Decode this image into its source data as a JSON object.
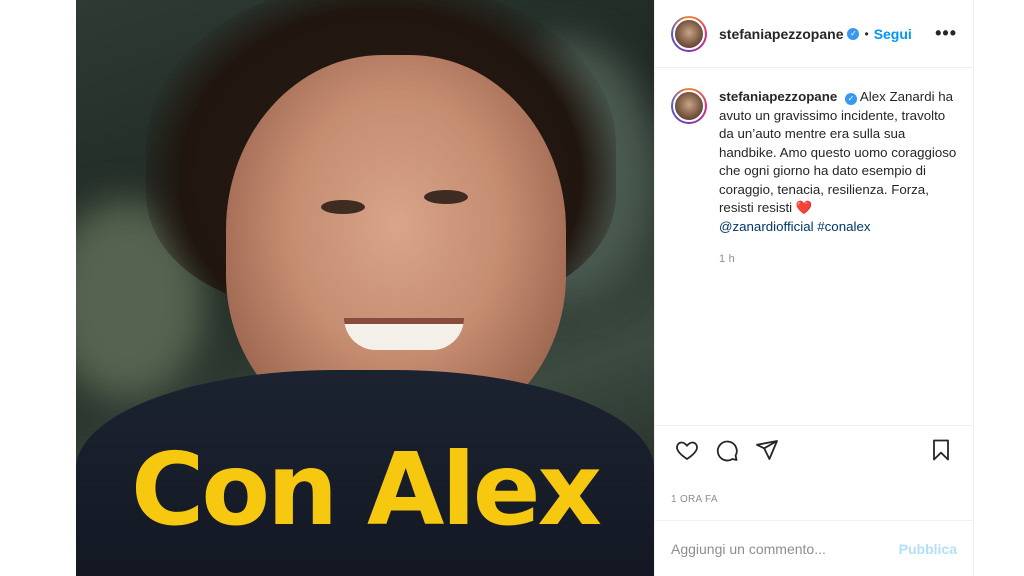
{
  "post": {
    "image_caption": "Con Alex",
    "caption_color": "#f6c910"
  },
  "header": {
    "username": "stefaniapezzopane",
    "verified_mark": "✓",
    "separator": "•",
    "follow_label": "Segui",
    "more_label": "•••"
  },
  "comment": {
    "username": "stefaniapezzopane",
    "text": "Alex Zanardi ha avuto un gravissimo incidente, travolto da un’auto mentre era sulla sua handbike. Amo questo uomo coraggioso che ogni giorno ha dato esempio di coraggio, tenacia, resilienza. Forza, resisti resisti",
    "emoji": "❤️",
    "mention": "@zanardiofficial",
    "hashtag": "#conalex",
    "time": "1 h"
  },
  "actions": {
    "icons": [
      "heart-icon",
      "comment-icon",
      "share-icon",
      "bookmark-icon"
    ]
  },
  "date_label": "1 ORA FA",
  "add_comment": {
    "placeholder": "Aggiungi un commento...",
    "publish_label": "Pubblica"
  },
  "colors": {
    "accent": "#0095f6",
    "link": "#00376b",
    "publish_disabled": "#b2dffc",
    "muted": "#8e8e8e"
  }
}
